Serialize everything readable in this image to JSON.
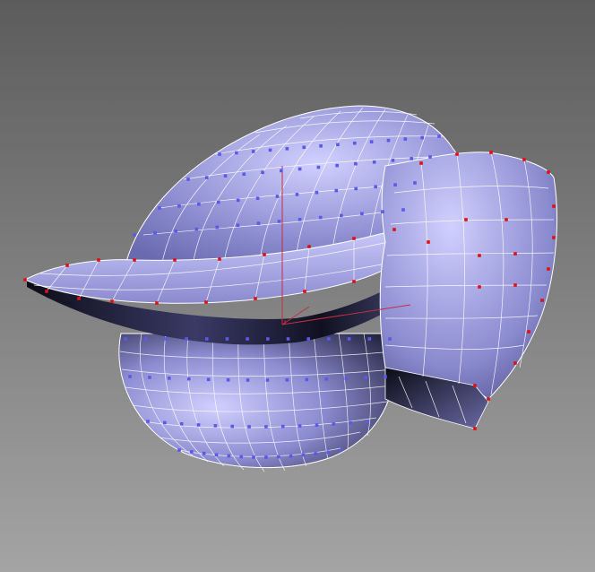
{
  "viewport": {
    "background_top": "#5c5c5c",
    "background_bottom": "#a4a4a4"
  },
  "model": {
    "surface_light": "#d0d0ff",
    "surface_mid": "#8a8acf",
    "surface_dark": "#23233f",
    "wire_color": "#ffffff",
    "selected_vertex_color": "#dd1111",
    "vertex_color": "#5a5ae6"
  },
  "gizmo": {
    "axis_color": "#c03040"
  }
}
